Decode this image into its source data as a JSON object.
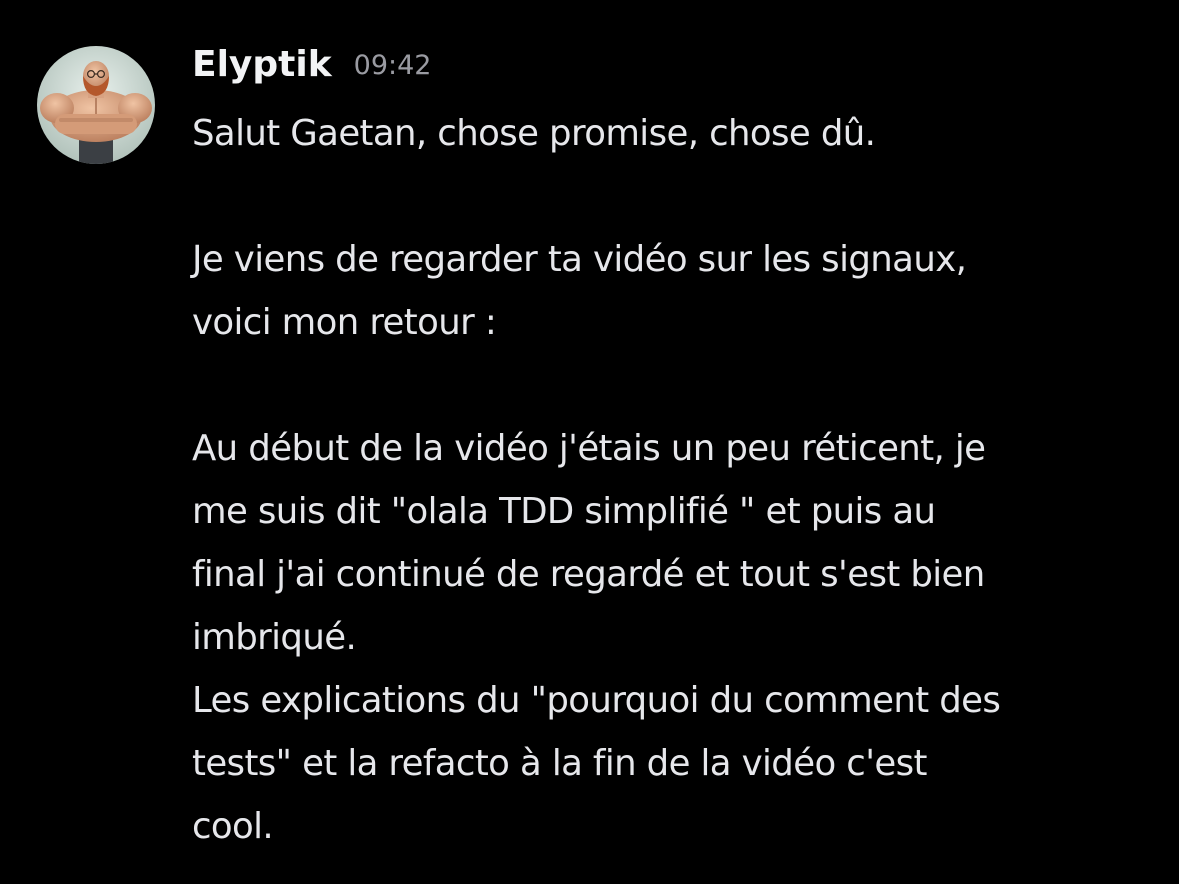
{
  "message": {
    "author": "Elyptik",
    "timestamp": "09:42",
    "avatar_icon": "muscular-bearded-man-avatar-icon",
    "lines": [
      "Salut Gaetan, chose promise, chose dû.",
      "",
      "Je viens de regarder ta vidéo sur les signaux,",
      "voici mon retour :",
      "",
      "Au début de la vidéo j'étais un peu réticent, je",
      "me suis dit \"olala TDD simplifié \" et puis au",
      "final j'ai continué de regardé et tout s'est bien",
      "imbriqué.",
      "Les explications du \"pourquoi du comment des",
      "tests\" et la refacto à la fin de la vidéo c'est",
      "cool."
    ]
  },
  "colors": {
    "background": "#000000",
    "text": "#e6e7eb",
    "username": "#f2f3f5",
    "timestamp": "#9a9ba2"
  }
}
